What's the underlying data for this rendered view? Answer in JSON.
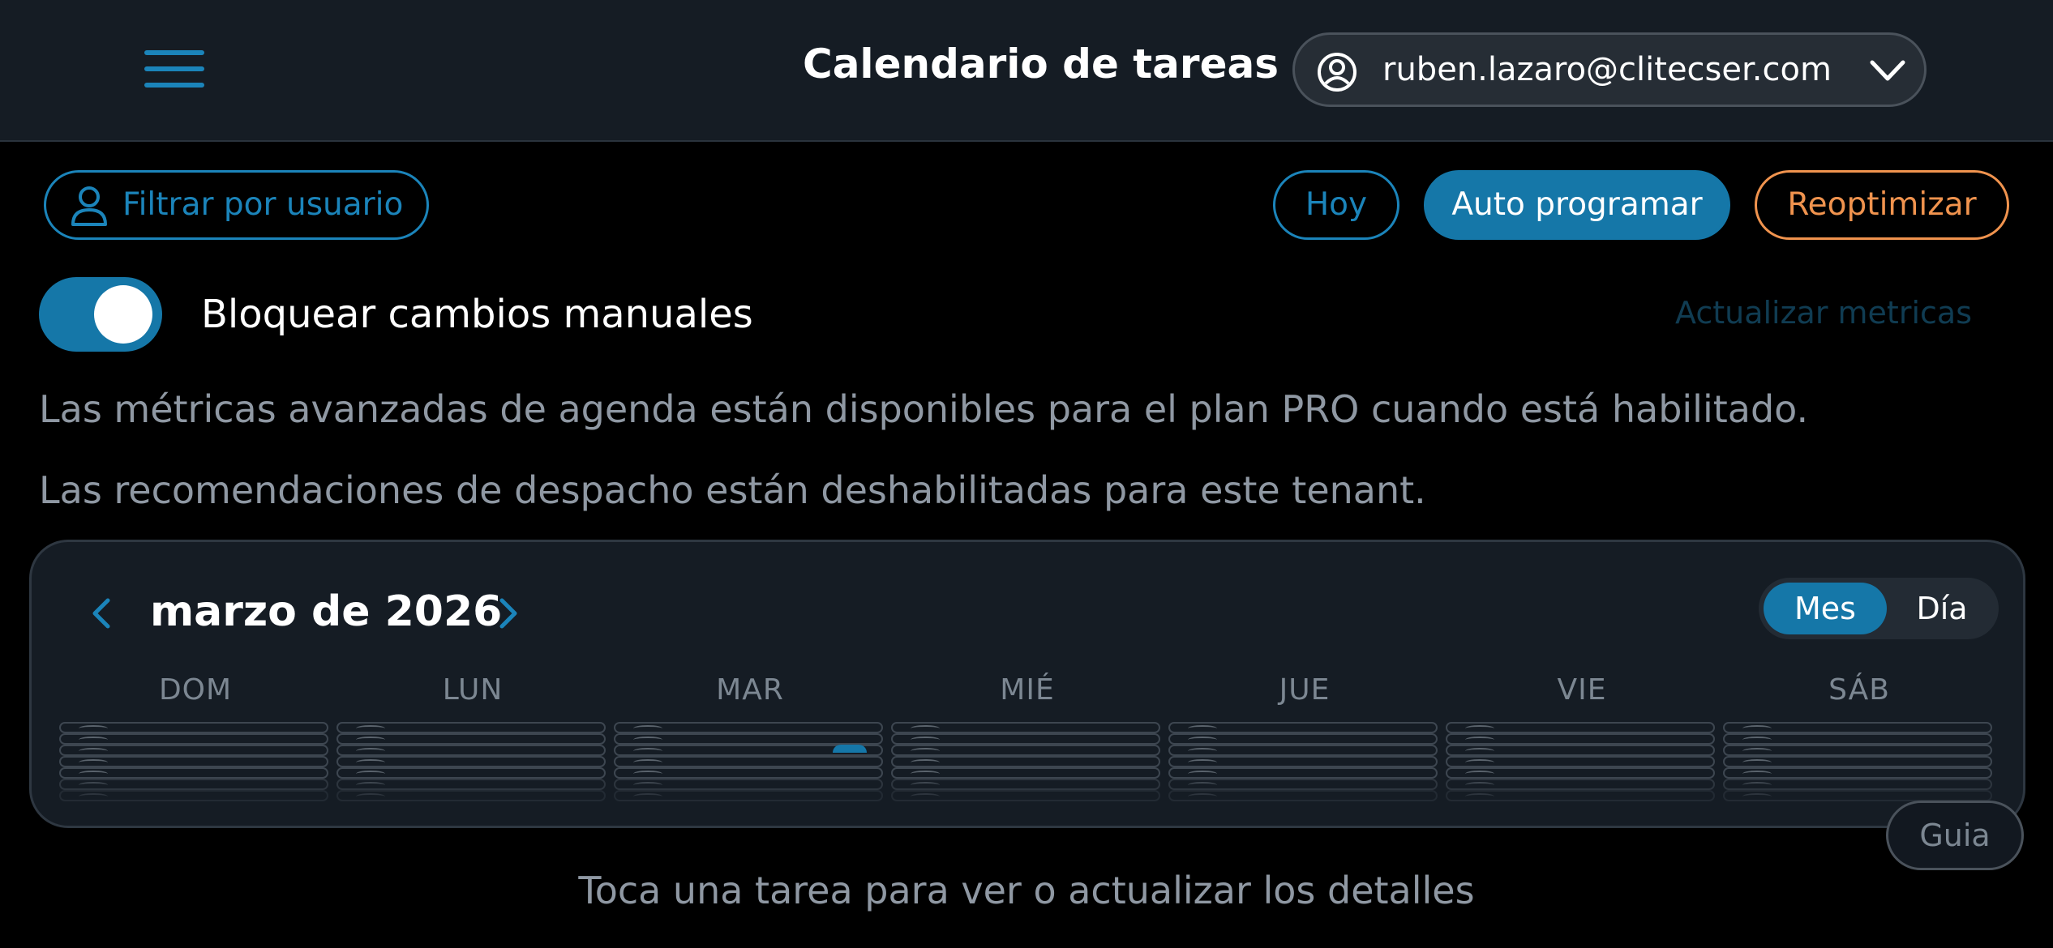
{
  "header": {
    "menu_icon": "hamburger-menu-icon",
    "title": "Calendario de tareas",
    "account": {
      "icon": "user-circle-icon",
      "email": "ruben.lazaro@clitecser.com",
      "dropdown_icon": "chevron-down-icon"
    }
  },
  "toolbar": {
    "filter_label": "Filtrar por usuario",
    "filter_icon": "person-icon",
    "today_label": "Hoy",
    "auto_schedule_label": "Auto programar",
    "reoptimize_label": "Reoptimizar"
  },
  "lock_toggle": {
    "label": "Bloquear cambios manuales",
    "enabled": true
  },
  "update_metrics_label": "Actualizar metricas",
  "notices": [
    "Las métricas avanzadas de agenda están disponibles para el plan PRO cuando está habilitado.",
    "Las recomendaciones de despacho están deshabilitadas para este tenant."
  ],
  "calendar": {
    "month_label": "marzo de 2026",
    "prev_icon": "chevron-left-icon",
    "next_icon": "chevron-right-icon",
    "views": [
      "Mes",
      "Día"
    ],
    "selected_view": "Mes",
    "weekdays": [
      "DOM",
      "LUN",
      "MAR",
      "MIÉ",
      "JUE",
      "VIE",
      "SÁB"
    ]
  },
  "guide_label": "Guia",
  "hint": "Toca una tarea para ver o actualizar los detalles",
  "colors": {
    "accent": "#1577a8",
    "accent_outline": "#1b84ba",
    "warning": "#f0934e",
    "header_bg": "#151c24",
    "background": "#000000"
  }
}
